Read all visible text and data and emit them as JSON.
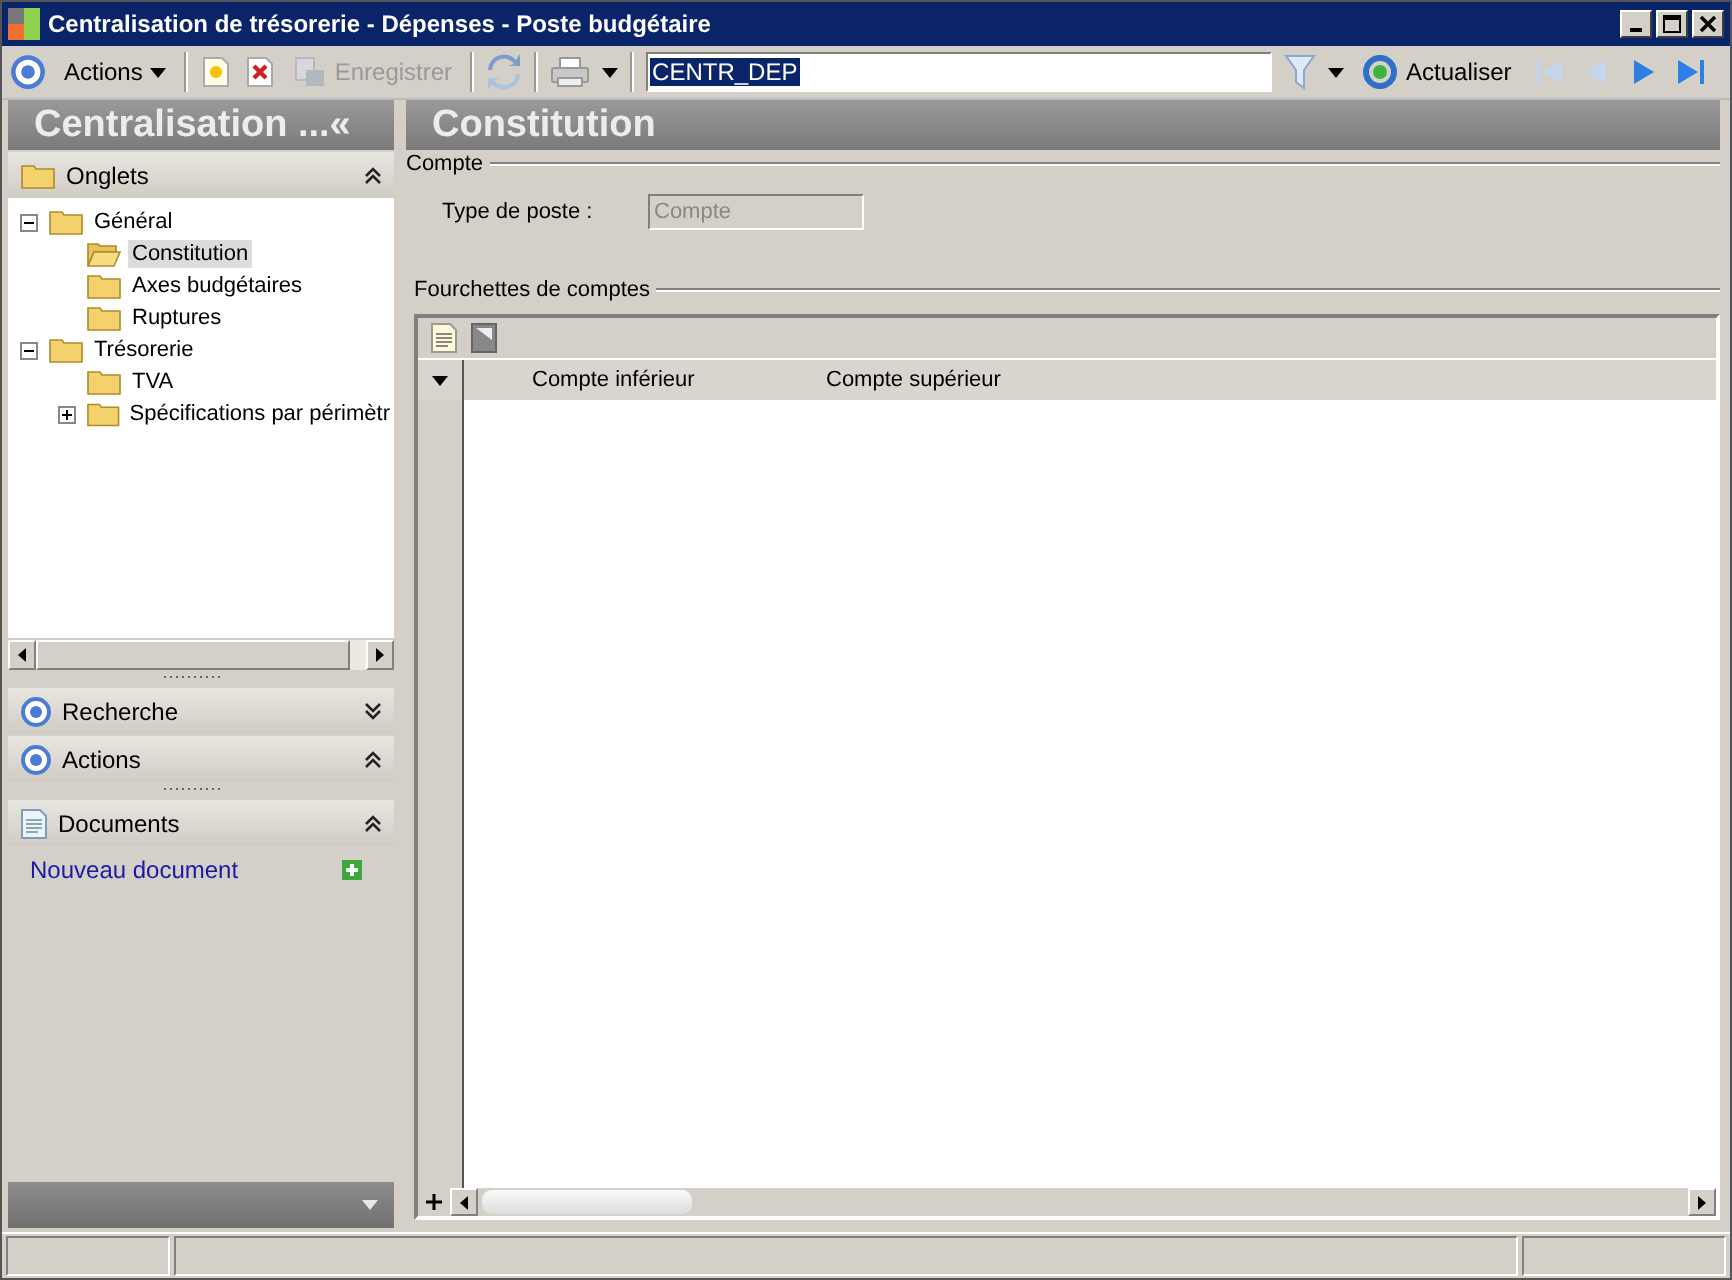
{
  "window": {
    "title": "Centralisation de trésorerie - Dépenses -  Poste budgétaire"
  },
  "toolbar": {
    "actions_label": "Actions",
    "save": {
      "label": "Enregistrer",
      "disabled": true
    },
    "code_value": "CENTR_DEP",
    "refresh_label": "Actualiser",
    "nav": [
      {
        "kind": "first",
        "disabled": true
      },
      {
        "kind": "prev",
        "disabled": true
      },
      {
        "kind": "next",
        "disabled": false
      },
      {
        "kind": "last",
        "disabled": false
      }
    ]
  },
  "left_panel": {
    "title": "Centralisation ...«",
    "sections": [
      {
        "kind": "tree",
        "label": "Onglets",
        "expanded": true
      },
      {
        "kind": "search",
        "label": "Recherche",
        "expanded": false
      },
      {
        "kind": "actions",
        "label": "Actions",
        "expanded": true
      },
      {
        "kind": "documents",
        "label": "Documents",
        "expanded": true
      }
    ],
    "tree": [
      {
        "label": "Général",
        "expanded": true,
        "selected": false,
        "children": [
          {
            "label": "Constitution",
            "selected": true
          },
          {
            "label": "Axes budgétaires",
            "selected": false
          },
          {
            "label": "Ruptures",
            "selected": false
          }
        ]
      },
      {
        "label": "Trésorerie",
        "expanded": true,
        "selected": false,
        "children": [
          {
            "label": "TVA",
            "selected": false
          },
          {
            "label": "Spécifications par périmètr",
            "expanded": false,
            "selected": false
          }
        ]
      }
    ],
    "new_document_link": "Nouveau document"
  },
  "main": {
    "title": "Constitution",
    "group_compte": {
      "legend": "Compte",
      "field_label": "Type de poste :",
      "field_value": "Compte"
    },
    "group_ranges": {
      "legend": "Fourchettes de comptes",
      "columns": [
        "Compte inférieur",
        "Compte supérieur"
      ]
    }
  }
}
